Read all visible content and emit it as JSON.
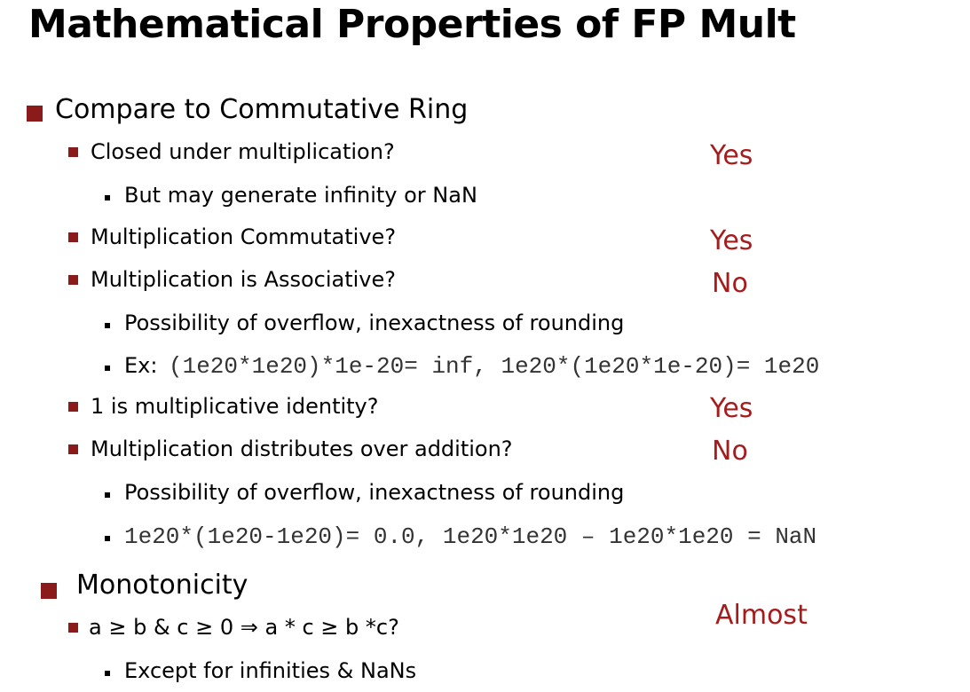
{
  "title": "Mathematical Properties of FP Mult",
  "sections": [
    {
      "heading": "Compare to Commutative Ring"
    },
    {
      "heading": "Monotonicity"
    }
  ],
  "items": {
    "closed": {
      "label": "Closed under multiplication?",
      "answer": "Yes",
      "sub": "But may generate infinity or NaN"
    },
    "commutative": {
      "label": "Multiplication Commutative?",
      "answer": "Yes"
    },
    "associative": {
      "label": "Multiplication is Associative?",
      "answer": "No",
      "sub1": "Possibility of overflow, inexactness of rounding",
      "ex_prefix": "Ex:",
      "ex_code": "(1e20*1e20)*1e-20= inf, 1e20*(1e20*1e-20)= 1e20"
    },
    "identity": {
      "label": "1 is multiplicative identity?",
      "answer": "Yes"
    },
    "distributes": {
      "label": "Multiplication distributes over addition?",
      "answer": "No",
      "sub1": "Possibility of overflow, inexactness of rounding",
      "code": "1e20*(1e20-1e20)= 0.0,  1e20*1e20 – 1e20*1e20 = NaN"
    },
    "monotone": {
      "label": "a ≥ b  & c ≥ 0  ⇒ a * c ≥ b *c?",
      "answer": "Almost",
      "sub": "Except for infinities & NaNs"
    }
  },
  "colors": {
    "bullet": "#8b1a1a",
    "answer": "#a51c1c"
  }
}
